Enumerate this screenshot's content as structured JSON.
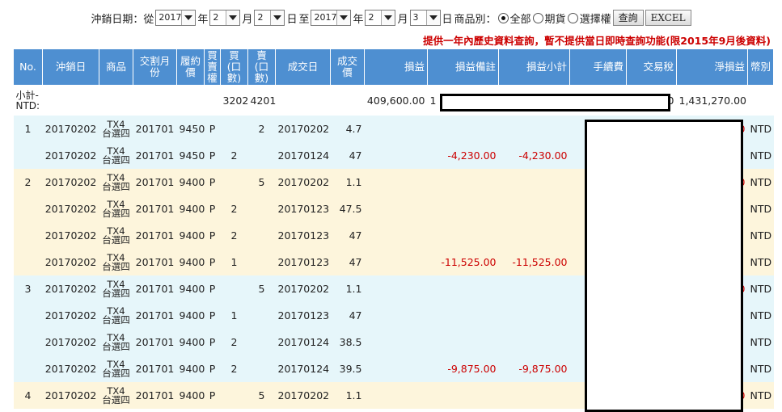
{
  "filter": {
    "label_date": "沖銷日期：從",
    "from_year": "2017",
    "from_month": "2",
    "from_day": "2",
    "to_label": "至",
    "to_year": "2017",
    "to_month": "2",
    "to_day": "3",
    "unit_year": "年",
    "unit_month": "月",
    "unit_day": "日",
    "product_label": "商品別：",
    "radio_all": "全部",
    "radio_futures": "期貨",
    "radio_options": "選擇權",
    "selected_radio": "全部",
    "query_button": "查詢",
    "excel_button": "EXCEL"
  },
  "notice": "提供一年內歷史資料查詢，暫不提供當日即時查詢功能(限2015年9月後資料)",
  "table": {
    "headers": [
      "No.",
      "沖銷日",
      "商品",
      "交割月份",
      "履約價",
      "買賣權",
      "買(口數)",
      "賣(口數)",
      "成交日",
      "成交價",
      "損益",
      "損益備註",
      "損益小計",
      "手續費",
      "交易稅",
      "淨損益",
      "幣別"
    ],
    "subtotal": {
      "label": "小計-NTD:",
      "buy": "3202",
      "sell": "4201",
      "pnl": "409,600.00",
      "note_fragment": "1",
      "tax_fragment": "0",
      "net": "1,431,270.00"
    },
    "rows": [
      {
        "no": "1",
        "date": "20170202",
        "prod1": "TX4",
        "prod2": "台選四",
        "month": "201701",
        "strike": "9450",
        "cp": "P",
        "buy": "",
        "sell": "2",
        "trade_date": "20170202",
        "price": "4.7",
        "pnl_note": "",
        "pnl_sub": "",
        "net_frag": "0",
        "ccy": "NTD"
      },
      {
        "no": "",
        "date": "20170202",
        "prod1": "TX4",
        "prod2": "台選四",
        "month": "201701",
        "strike": "9450",
        "cp": "P",
        "buy": "2",
        "sell": "",
        "trade_date": "20170124",
        "price": "47",
        "pnl_note": "-4,230.00",
        "pnl_sub": "-4,230.00",
        "net_frag": "",
        "ccy": "NTD"
      },
      {
        "no": "2",
        "date": "20170202",
        "prod1": "TX4",
        "prod2": "台選四",
        "month": "201701",
        "strike": "9400",
        "cp": "P",
        "buy": "",
        "sell": "5",
        "trade_date": "20170202",
        "price": "1.1",
        "pnl_note": "",
        "pnl_sub": "",
        "net_frag": "0",
        "ccy": "NTD"
      },
      {
        "no": "",
        "date": "20170202",
        "prod1": "TX4",
        "prod2": "台選四",
        "month": "201701",
        "strike": "9400",
        "cp": "P",
        "buy": "2",
        "sell": "",
        "trade_date": "20170123",
        "price": "47.5",
        "pnl_note": "",
        "pnl_sub": "",
        "net_frag": "",
        "ccy": "NTD"
      },
      {
        "no": "",
        "date": "20170202",
        "prod1": "TX4",
        "prod2": "台選四",
        "month": "201701",
        "strike": "9400",
        "cp": "P",
        "buy": "2",
        "sell": "",
        "trade_date": "20170123",
        "price": "47",
        "pnl_note": "",
        "pnl_sub": "",
        "net_frag": "",
        "ccy": "NTD"
      },
      {
        "no": "",
        "date": "20170202",
        "prod1": "TX4",
        "prod2": "台選四",
        "month": "201701",
        "strike": "9400",
        "cp": "P",
        "buy": "1",
        "sell": "",
        "trade_date": "20170123",
        "price": "47",
        "pnl_note": "-11,525.00",
        "pnl_sub": "-11,525.00",
        "net_frag": "",
        "ccy": "NTD"
      },
      {
        "no": "3",
        "date": "20170202",
        "prod1": "TX4",
        "prod2": "台選四",
        "month": "201701",
        "strike": "9400",
        "cp": "P",
        "buy": "",
        "sell": "5",
        "trade_date": "20170202",
        "price": "1.1",
        "pnl_note": "",
        "pnl_sub": "",
        "net_frag": "0",
        "ccy": "NTD"
      },
      {
        "no": "",
        "date": "20170202",
        "prod1": "TX4",
        "prod2": "台選四",
        "month": "201701",
        "strike": "9400",
        "cp": "P",
        "buy": "1",
        "sell": "",
        "trade_date": "20170123",
        "price": "47",
        "pnl_note": "",
        "pnl_sub": "",
        "net_frag": "",
        "ccy": "NTD"
      },
      {
        "no": "",
        "date": "20170202",
        "prod1": "TX4",
        "prod2": "台選四",
        "month": "201701",
        "strike": "9400",
        "cp": "P",
        "buy": "2",
        "sell": "",
        "trade_date": "20170124",
        "price": "38.5",
        "pnl_note": "",
        "pnl_sub": "",
        "net_frag": "",
        "ccy": "NTD"
      },
      {
        "no": "",
        "date": "20170202",
        "prod1": "TX4",
        "prod2": "台選四",
        "month": "201701",
        "strike": "9400",
        "cp": "P",
        "buy": "2",
        "sell": "",
        "trade_date": "20170124",
        "price": "39.5",
        "pnl_note": "-9,875.00",
        "pnl_sub": "-9,875.00",
        "net_frag": "",
        "ccy": "NTD"
      },
      {
        "no": "4",
        "date": "20170202",
        "prod1": "TX4",
        "prod2": "台選四",
        "month": "201701",
        "strike": "9400",
        "cp": "P",
        "buy": "",
        "sell": "5",
        "trade_date": "20170202",
        "price": "1.1",
        "pnl_note": "",
        "pnl_sub": "",
        "net_frag": "0",
        "ccy": "NTD"
      }
    ]
  },
  "colors": {
    "header_bg": "#4e8fd1",
    "row_blue": "#e6f6fa",
    "row_yellow": "#fdf5dc",
    "negative": "#cc0000",
    "notice": "#cc0000"
  }
}
